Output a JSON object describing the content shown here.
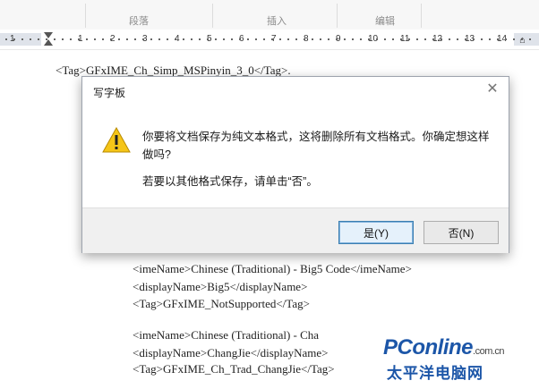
{
  "ribbon": {
    "groups": [
      "段落",
      "插入",
      "编辑"
    ]
  },
  "ruler": {
    "numbers": [
      "1",
      "1",
      "2",
      "3",
      "4",
      "5",
      "6",
      "7",
      "8",
      "9",
      "10",
      "11",
      "12",
      "13",
      "14"
    ]
  },
  "document": {
    "line_top": "<Tag>GFxIME_Ch_Simp_MSPinyin_3_0</Tag>.",
    "lines": [
      "<imeName>Chinese (Traditional) - Big5 Code</imeName>",
      "<displayName>Big5</displayName>",
      "<Tag>GFxIME_NotSupported</Tag>",
      "<imeName>Chinese (Traditional) - Cha",
      "<displayName>ChangJie</displayName>",
      "<Tag>GFxIME_Ch_Trad_ChangJie</Tag>"
    ]
  },
  "dialog": {
    "title": "写字板",
    "close_icon": "close-icon",
    "warning_icon": "warning-icon",
    "message": "你要将文档保存为纯文本格式，这将删除所有文档格式。你确定想这样做吗?",
    "message2": "若要以其他格式保存，请单击“否”。",
    "yes_label": "是(Y)",
    "no_label": "否(N)"
  },
  "watermark": {
    "brand": "PConline",
    "domain": ".com.cn",
    "cn": "太平洋电脑网"
  },
  "colors": {
    "warning": "#f5c518",
    "brand": "#1c56a8",
    "accent_border": "#3c7fb1"
  }
}
